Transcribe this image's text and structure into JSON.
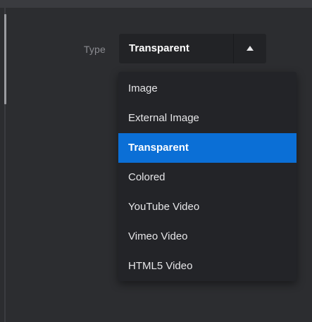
{
  "field": {
    "label": "Type",
    "selected_value": "Transparent",
    "caret_icon": "caret-up-icon"
  },
  "dropdown": {
    "options": [
      {
        "label": "Image",
        "selected": false
      },
      {
        "label": "External Image",
        "selected": false
      },
      {
        "label": "Transparent",
        "selected": true
      },
      {
        "label": "Colored",
        "selected": false
      },
      {
        "label": "YouTube Video",
        "selected": false
      },
      {
        "label": "Vimeo Video",
        "selected": false
      },
      {
        "label": "HTML5 Video",
        "selected": false
      }
    ]
  },
  "colors": {
    "background": "#2c2d30",
    "select_background": "#222326",
    "dropdown_background": "#232428",
    "selected_highlight": "#0b6fd6",
    "label_text": "#8a8b90",
    "option_text": "#e6e6e8"
  }
}
